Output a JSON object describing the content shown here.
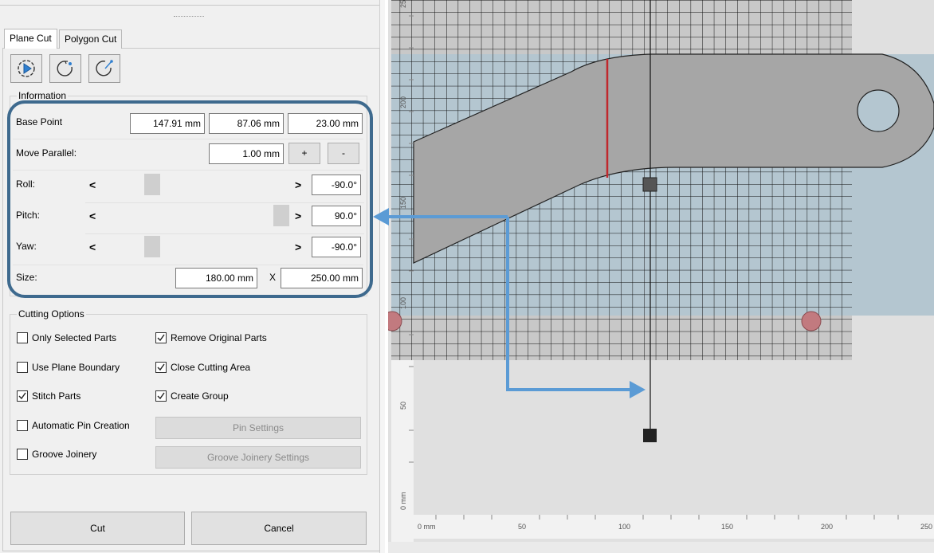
{
  "tabs": [
    {
      "label": "Plane Cut",
      "active": true
    },
    {
      "label": "Polygon Cut",
      "active": false
    }
  ],
  "tool_icons": [
    "plane-rotate-icon",
    "rotate-arc-icon",
    "rotate-arc-alt-icon"
  ],
  "information": {
    "title": "Information",
    "base_point": {
      "label": "Base Point",
      "x": "147.91 mm",
      "y": "87.06 mm",
      "z": "23.00 mm"
    },
    "move_parallel": {
      "label": "Move Parallel:",
      "value": "1.00 mm",
      "plus": "+",
      "minus": "-"
    },
    "roll": {
      "label": "Roll:",
      "value": "-90.0°",
      "slider_fraction": 0.3
    },
    "pitch": {
      "label": "Pitch:",
      "value": "90.0°",
      "slider_fraction": 0.96
    },
    "yaw": {
      "label": "Yaw:",
      "value": "-90.0°",
      "slider_fraction": 0.3
    },
    "size": {
      "label": "Size:",
      "width": "180.00 mm",
      "separator": "X",
      "height": "250.00 mm"
    },
    "arrow_left": "<",
    "arrow_right": ">"
  },
  "cutting_options": {
    "title": "Cutting Options",
    "only_selected_parts": {
      "label": "Only Selected Parts",
      "checked": false
    },
    "remove_original_parts": {
      "label": "Remove Original Parts",
      "checked": true
    },
    "use_plane_boundary": {
      "label": "Use Plane Boundary",
      "checked": false
    },
    "close_cutting_area": {
      "label": "Close Cutting Area",
      "checked": true
    },
    "stitch_parts": {
      "label": "Stitch Parts",
      "checked": true
    },
    "create_group": {
      "label": "Create Group",
      "checked": true
    },
    "automatic_pin_creation": {
      "label": "Automatic Pin Creation",
      "checked": false
    },
    "groove_joinery": {
      "label": "Groove Joinery",
      "checked": false
    },
    "pin_settings": "Pin Settings",
    "groove_joinery_settings": "Groove Joinery Settings"
  },
  "actions": {
    "cut": "Cut",
    "cancel": "Cancel"
  },
  "ruler": {
    "horizontal": [
      "0 mm",
      "50",
      "100",
      "150",
      "200",
      "250"
    ],
    "vertical": [
      "250",
      "200",
      "150",
      "100",
      "50",
      "0 mm"
    ]
  },
  "colors": {
    "highlight_frame": "#3e6a8e",
    "callout_arrow": "#5b9bd5",
    "cut_line": "#c0282d",
    "part_gray": "#a6a6a6",
    "plane_blue": "#b4c6d0",
    "pin_marker": "#c27a7f"
  }
}
